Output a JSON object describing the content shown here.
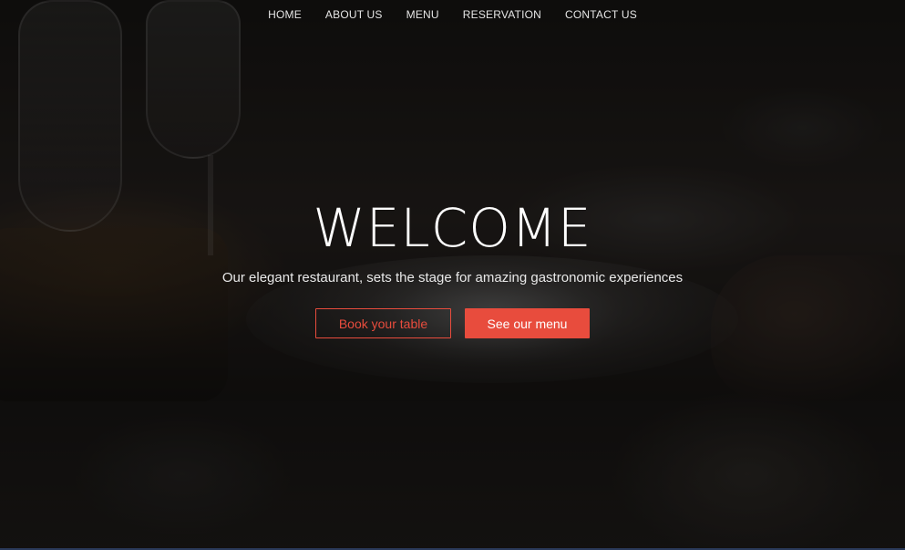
{
  "nav": {
    "items": [
      {
        "label": "HOME"
      },
      {
        "label": "ABOUT US"
      },
      {
        "label": "MENU"
      },
      {
        "label": "RESERVATION"
      },
      {
        "label": "CONTACT US"
      }
    ]
  },
  "hero": {
    "title": "WELCOME",
    "subtitle": "Our elegant restaurant, sets the stage for amazing gastronomic experiences",
    "book_button": "Book your table",
    "menu_button": "See our menu"
  },
  "colors": {
    "accent": "#e84c3d",
    "text": "#ffffff"
  }
}
